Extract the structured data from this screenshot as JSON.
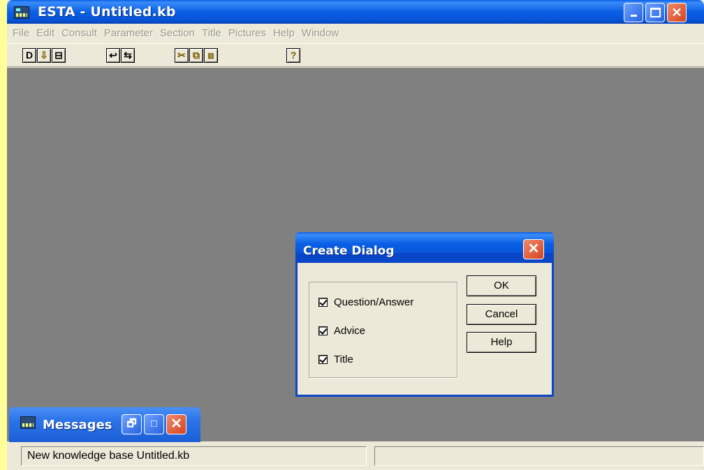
{
  "window": {
    "title": "ESTA - Untitled.kb",
    "app_icon": "esta-app-icon",
    "minimize_icon": "minimize-icon",
    "maximize_icon": "maximize-icon",
    "close_icon": "close-icon",
    "close_glyph": "✕"
  },
  "menu": {
    "items": [
      "File",
      "Edit",
      "Consult",
      "Parameter",
      "Section",
      "Title",
      "Pictures",
      "Help",
      "Window"
    ],
    "disabled_color": "#9a9888"
  },
  "toolbar": {
    "buttons": [
      {
        "name": "new-file-icon",
        "glyph": "D"
      },
      {
        "name": "open-file-icon",
        "glyph": "⇩"
      },
      {
        "name": "save-icon",
        "glyph": "⊟"
      },
      {
        "name": "undo-icon",
        "glyph": "↩"
      },
      {
        "name": "redo-icon",
        "glyph": "⇆"
      },
      {
        "name": "cut-icon",
        "glyph": "✂"
      },
      {
        "name": "copy-icon",
        "glyph": "⧉"
      },
      {
        "name": "paste-icon",
        "glyph": "⧈"
      },
      {
        "name": "help-icon",
        "glyph": "?"
      }
    ]
  },
  "dialog": {
    "title": "Create Dialog",
    "close_glyph": "✕",
    "options": [
      {
        "label": "Question/Answer",
        "checked": true
      },
      {
        "label": "Advice",
        "checked": true
      },
      {
        "label": "Title",
        "checked": true
      }
    ],
    "ok_label": "OK",
    "cancel_label": "Cancel",
    "help_label": "Help"
  },
  "messages": {
    "title": "Messages",
    "restore_glyph": "🗗",
    "maximize_glyph": "□",
    "close_glyph": "✕"
  },
  "status": {
    "message": "New knowledge base Untitled.kb",
    "secondary": ""
  },
  "colors": {
    "workspace": "#808080",
    "titlebar": "#0a5ee8",
    "close_button": "#d44420",
    "background": "#ffff99"
  }
}
